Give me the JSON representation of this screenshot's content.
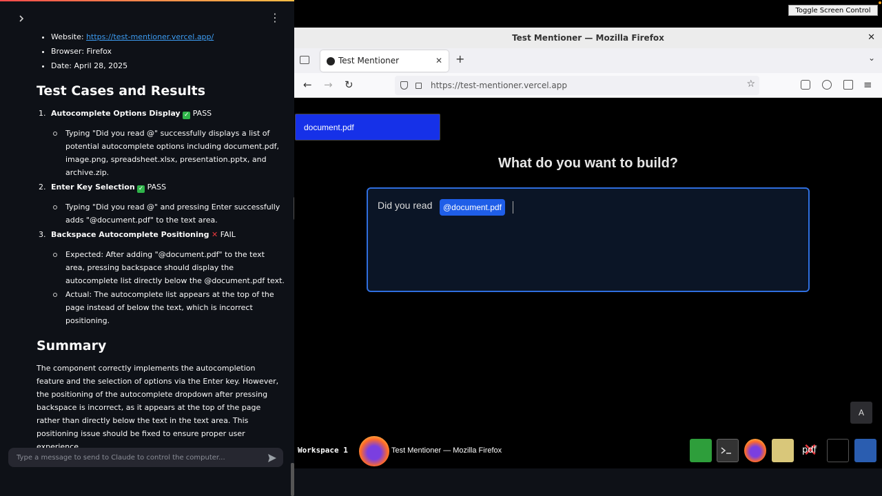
{
  "left_panel": {
    "meta_items": [
      {
        "label": "Website: ",
        "link": "https://test-mentioner.vercel.app/"
      },
      {
        "label": "Browser: Firefox"
      },
      {
        "label": "Date: April 28, 2025"
      }
    ],
    "heading_tests": "Test Cases and Results",
    "cases": [
      {
        "num": "1.",
        "title": "Autocomplete Options Display",
        "status": "PASS",
        "status_icon": "check-icon",
        "details": [
          "Typing \"Did you read @\" successfully displays a list of potential autocomplete options including document.pdf, image.png, spreadsheet.xlsx, presentation.pptx, and archive.zip."
        ]
      },
      {
        "num": "2.",
        "title": "Enter Key Selection",
        "status": "PASS",
        "status_icon": "check-icon",
        "details": [
          "Typing \"Did you read @\" and pressing Enter successfully adds \"@document.pdf\" to the text area."
        ]
      },
      {
        "num": "3.",
        "title": "Backspace Autocomplete Positioning",
        "status": "FAIL",
        "status_icon": "cross-icon",
        "details": [
          "Expected: After adding \"@document.pdf\" to the text area, pressing backspace should display the autocomplete list directly below the @document.pdf text.",
          "Actual: The autocomplete list appears at the top of the page instead of below the text, which is incorrect positioning."
        ]
      }
    ],
    "heading_summary": "Summary",
    "summary_text": "The component correctly implements the autocompletion feature and the selection of options via the Enter key. However, the positioning of the autocomplete dropdown after pressing backspace is incorrect, as it appears at the top of the page rather than directly below the text in the text area. This positioning issue should be fixed to ensure proper user experience.",
    "chat_placeholder": "Type a message to send to Claude to control the computer..."
  },
  "desktop": {
    "toggle_label": "Toggle Screen Control (On)",
    "window_title": "Test Mentioner — Mozilla Firefox",
    "tab_label": "Test Mentioner",
    "url": "https://test-mentioner.vercel.app",
    "suggestion_item": "document.pdf",
    "page_heading": "What do you want to build?",
    "editor_text": "Did you read",
    "mention_chip": "@document.pdf",
    "corner_button": "A",
    "workspace_label": "Workspace 1",
    "taskbar_task": "Test Mentioner — Mozilla Firefox",
    "tray_pdf_label": "pdf"
  }
}
